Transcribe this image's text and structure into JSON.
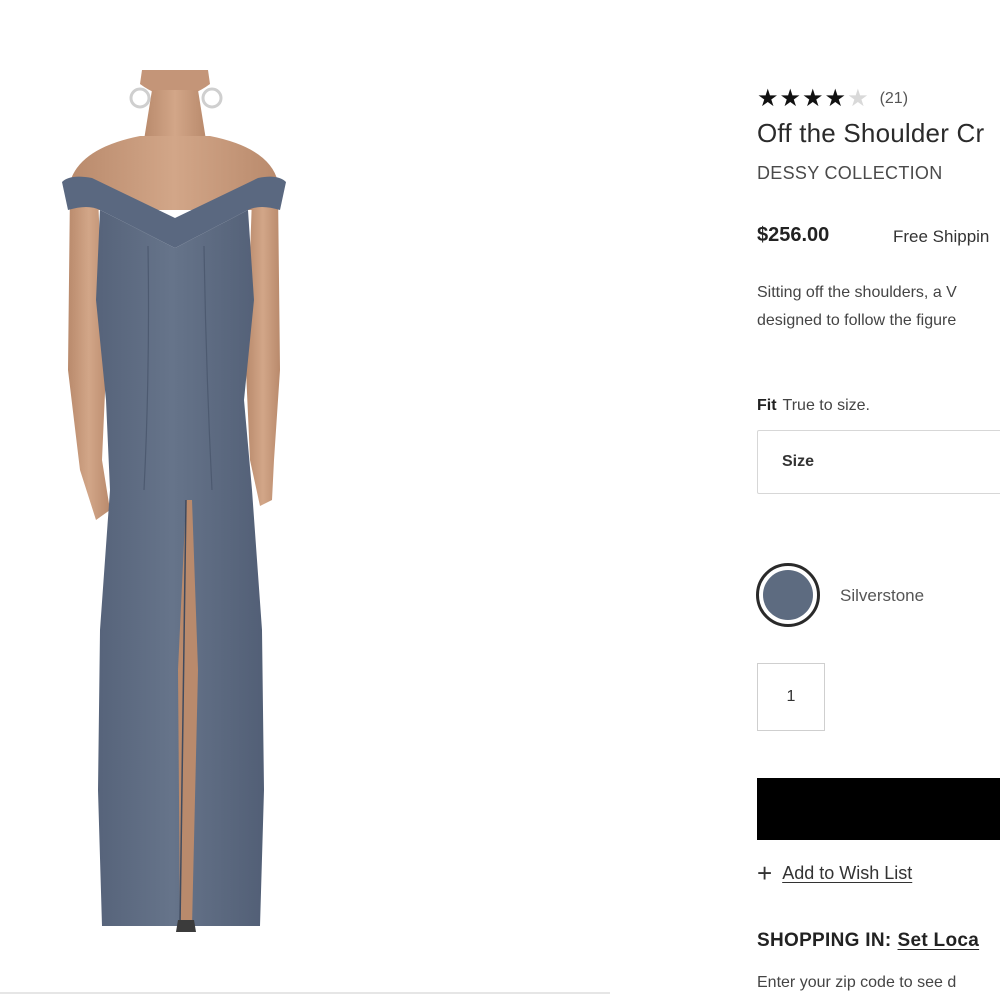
{
  "product": {
    "rating": 4,
    "rating_max": 5,
    "review_count": "(21)",
    "title": "Off the Shoulder Cr",
    "brand": "DESSY COLLECTION",
    "price": "$256.00",
    "shipping": "Free Shippin",
    "description": [
      "Sitting off the shoulders, a V",
      "designed to follow the figure"
    ],
    "image_icon": "model-in-off-shoulder-gown",
    "dress_color": "#5d6b80"
  },
  "fit": {
    "label": "Fit",
    "value": "True to size."
  },
  "size_select": {
    "label": "Size"
  },
  "color": {
    "name": "Silverstone",
    "hex": "#5d6b80"
  },
  "quantity": {
    "value": "1"
  },
  "actions": {
    "wishlist_icon": "plus-icon",
    "wishlist_label": "Add to Wish List"
  },
  "shopping": {
    "label": "SHOPPING IN:",
    "location_link": "Set Loca",
    "zip_note": "Enter your zip code to see d"
  }
}
